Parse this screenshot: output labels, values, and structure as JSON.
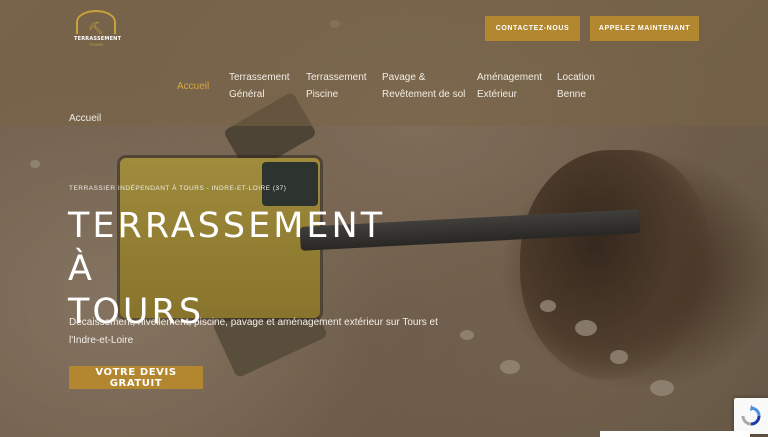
{
  "brand": {
    "name": "TERRASSEMENT",
    "sub": "TOURS",
    "accent": "#b2872f"
  },
  "header": {
    "contact_label": "CONTACTEZ-NOUS",
    "call_label": "APPELEZ MAINTENANT"
  },
  "nav": {
    "items": [
      {
        "line1": "Accueil",
        "line2": ""
      },
      {
        "line1": "Terrassement",
        "line2": "Général"
      },
      {
        "line1": "Terrassement",
        "line2": "Piscine"
      },
      {
        "line1": "Pavage &",
        "line2": "Revêtement de sol"
      },
      {
        "line1": "Aménagement",
        "line2": "Extérieur"
      },
      {
        "line1": "Location",
        "line2": "Benne"
      }
    ],
    "breadcrumb": "Accueil"
  },
  "hero": {
    "kicker": "TERRASSIER INDÉPENDANT À TOURS - INDRE-ET-LOIRE (37)",
    "title_line1": "TERRASSEMENT À",
    "title_line2": "TOURS",
    "subtitle": "Décaissement, nivellement, piscine, pavage et aménagement extérieur sur Tours et l'Indre-et-Loire",
    "cta_label": "VOTRE DEVIS GRATUIT"
  },
  "icons": {
    "recaptcha": "recaptcha-icon",
    "logo": "excavator-logo-icon"
  }
}
